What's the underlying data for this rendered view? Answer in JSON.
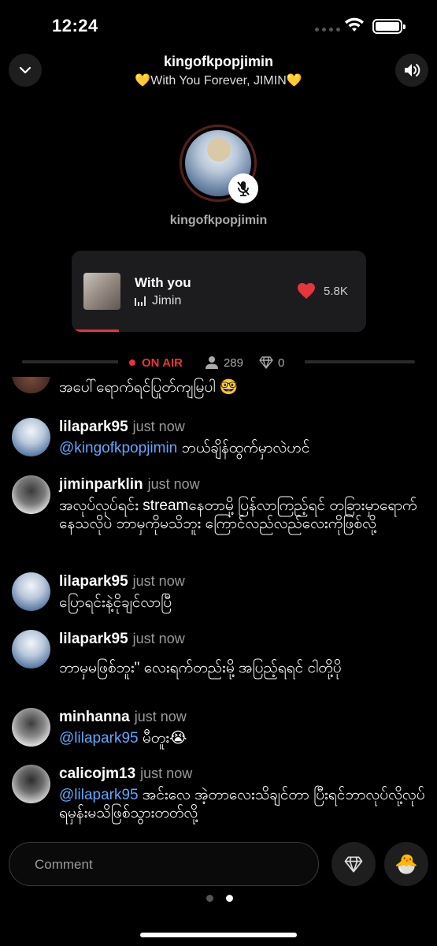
{
  "status_bar": {
    "time": "12:24"
  },
  "header": {
    "title": "kingofkpopjimin",
    "subtitle": "💛With You Forever, JIMIN💛"
  },
  "host": {
    "name": "kingofkpopjimin"
  },
  "now_playing": {
    "title": "With you",
    "artist": "Jimin",
    "likes": "5.8K",
    "progress": 0.16
  },
  "broadcast": {
    "status": "ON AIR",
    "listeners": "289",
    "gems": "0"
  },
  "chat": {
    "partial_message": "အပေါ်ရောက်ရင်ပြုတ်ကျမြပါ 🤓",
    "messages": [
      {
        "user": "lilapark95",
        "time": "just now",
        "mention": "@kingofkpopjimin",
        "text": " ဘယ်ချိန်ထွက်မှာလဲဟင်"
      },
      {
        "user": "jiminparklin",
        "time": "just now",
        "mention": "",
        "text": "အလုပ်လုပ်ရင်း streamနေတာမို့ ပြန်လာကြည့်ရင် တခြားမှာရောက်နေသလိုပဲ ဘာမှကိုမသိဘူး ကြောင်လည်လည်လေးကိုဖြစ်လို့"
      },
      {
        "user": "lilapark95",
        "time": "just now",
        "mention": "",
        "text": "ပြောရင်းနဲ့ငိုချင်လာပြီ"
      },
      {
        "user": "lilapark95",
        "time": "just now",
        "mention": "",
        "text": "ဘာမှမဖြစ်ဘူး\" လေးရက်တည်းမို့ အပြည့်ရရင် ငါတို့ပို"
      },
      {
        "user": "minhanna",
        "time": "just now",
        "mention": "@lilapark95",
        "text": " မီတူး😭"
      },
      {
        "user": "calicojm13",
        "time": "just now",
        "mention": "@lilapark95",
        "text": " အင်းလေ အဲ့တာလေးသိချင်တာ ပြီးရင်ဘာလုပ်လို့လုပ်ရမှန်းမသိဖြစ်သွားတတ်လို့"
      }
    ]
  },
  "comment": {
    "placeholder": "Comment"
  },
  "pager": {
    "pages": 2,
    "active": 2
  },
  "icons": {
    "back": "chevron-down-icon",
    "sound": "speaker-icon",
    "mic": "mic-off-icon",
    "heart": "heart-icon",
    "listeners": "person-icon",
    "gems": "diamond-icon",
    "gift": "hatching-chick-icon"
  },
  "colors": {
    "accent": "#e5353d",
    "mention": "#5fa8ff",
    "background": "#000000",
    "card": "#1c1c1e"
  }
}
